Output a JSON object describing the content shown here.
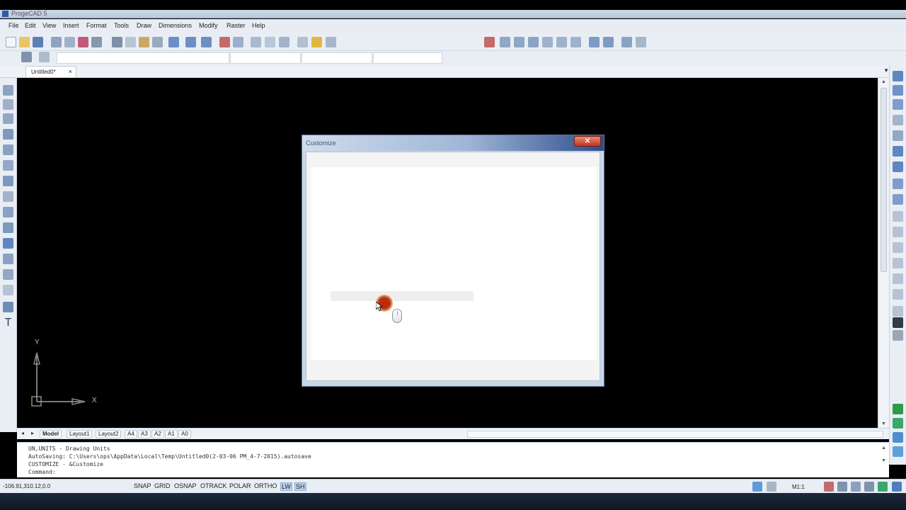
{
  "window": {
    "title": "ProgeCAD 5"
  },
  "menu": [
    "File",
    "Edit",
    "View",
    "Insert",
    "Format",
    "Tools",
    "Draw",
    "Dimensions",
    "Modify",
    "Raster",
    "Help"
  ],
  "document_tab": {
    "label": "Untitled0*",
    "close": "×"
  },
  "ucs": {
    "x_label": "X",
    "y_label": "Y"
  },
  "layout_tabs": [
    "Model",
    "Layout1",
    "Layout2",
    "A4",
    "A3",
    "A2",
    "A1",
    "A0"
  ],
  "command_history": [
    "UN,UNITS - Drawing Units",
    "AutoSaving: C:\\Users\\ops\\AppData\\Local\\Temp\\Untitled0(2-03-06 PM_4-7-2015).autosave",
    "CUSTOMIZE - &Customize",
    "Command:"
  ],
  "status": {
    "coordinates": "-106.91,310.12,0.0",
    "toggles": [
      {
        "label": "SNAP",
        "on": false
      },
      {
        "label": "GRID",
        "on": false
      },
      {
        "label": "OSNAP",
        "on": false
      },
      {
        "label": "OTRACK",
        "on": false
      },
      {
        "label": "POLAR",
        "on": false
      },
      {
        "label": "ORTHO",
        "on": false
      },
      {
        "label": "LW",
        "on": true
      },
      {
        "label": "SH",
        "on": true
      }
    ],
    "scale": "M1:1"
  },
  "dialog": {
    "title": "Customize",
    "close": "✕"
  },
  "colors": {
    "canvas": "#000000",
    "dialog_close": "#c0351f",
    "spinner": "#b8300f"
  }
}
